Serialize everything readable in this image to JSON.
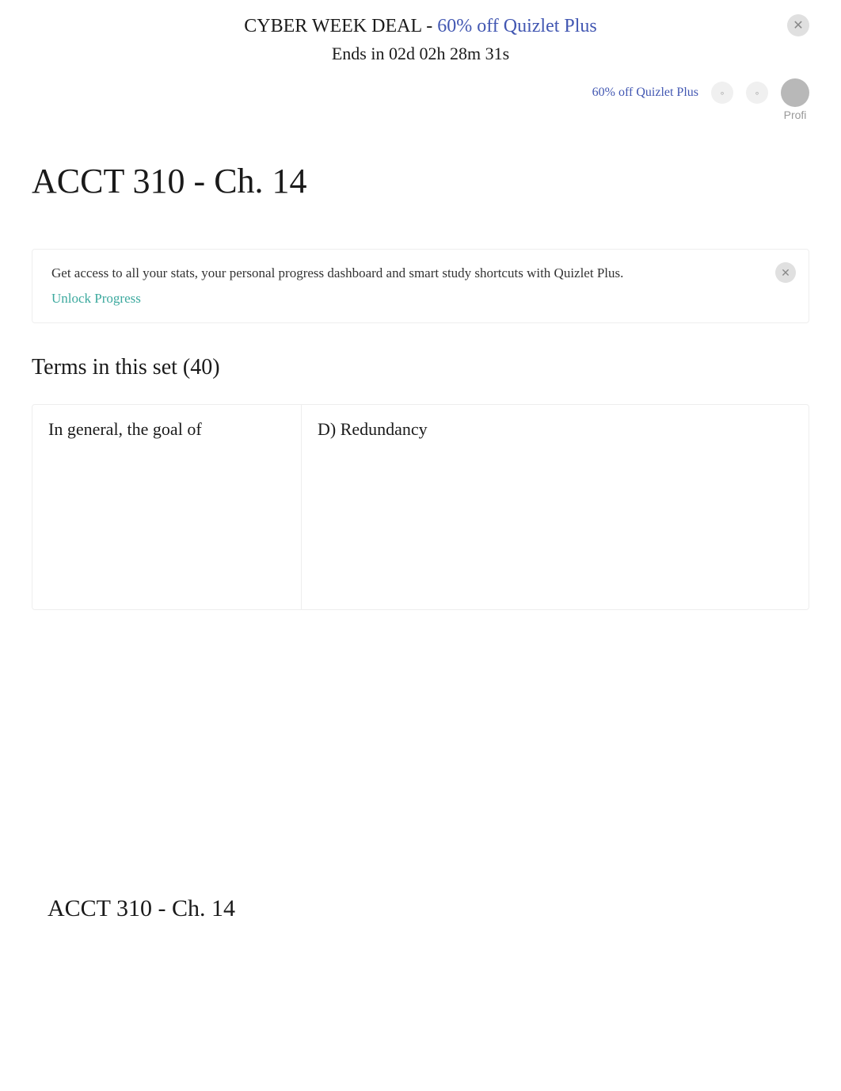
{
  "promo": {
    "title_prefix": "CYBER WEEK DEAL - ",
    "deal_link": "60% off Quizlet Plus",
    "countdown": "Ends in 02d 02h 28m 31s"
  },
  "top_bar": {
    "plus_link": "60% off Quizlet Plus",
    "profile_label": "Profi"
  },
  "page_title": "ACCT 310 - Ch. 14",
  "upsell": {
    "text": "Get access to all your stats, your personal progress dashboard and smart study shortcuts with Quizlet Plus.",
    "unlock": "Unlock Progress"
  },
  "terms_heading": "Terms in this set (40)",
  "card": {
    "term": "In general, the goal of",
    "definition": "D) Redundancy"
  },
  "footer_title": "ACCT 310 - Ch. 14"
}
